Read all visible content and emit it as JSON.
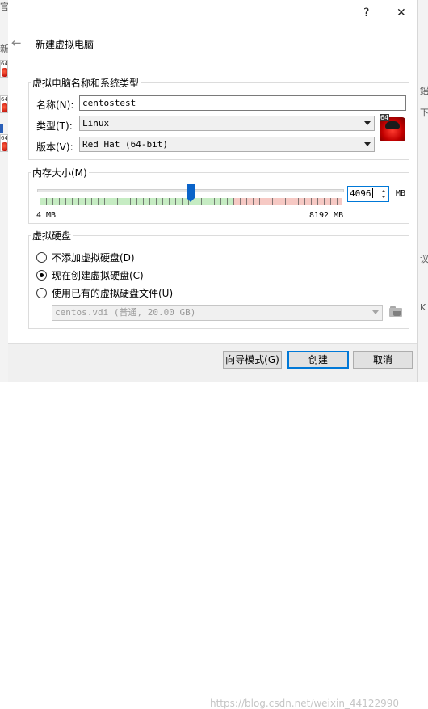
{
  "background": {
    "left_fragments": [
      "官",
      "新"
    ],
    "left_thumb_numbers": [
      "64",
      "64",
      "64"
    ],
    "right_fragments": [
      "鎐",
      "下",
      "议",
      "K"
    ]
  },
  "header": {
    "help_icon": "?",
    "close_icon": "✕",
    "back_icon": "←",
    "title": "新建虚拟电脑"
  },
  "name_group": {
    "legend": "虚拟电脑名称和系统类型",
    "name_label": "名称(N):",
    "name_value": "centostest",
    "type_label": "类型(T):",
    "type_value": "Linux",
    "version_label": "版本(V):",
    "version_value": "Red Hat (64-bit)",
    "os_badge": "64"
  },
  "memory_group": {
    "legend": "内存大小(M)",
    "min_label": "4 MB",
    "max_label": "8192 MB",
    "value": "4096",
    "unit": "MB",
    "slider_value": 4096,
    "slider_min": 4,
    "slider_max": 8192,
    "recommended_max_fraction": 0.64
  },
  "disk_group": {
    "legend": "虚拟硬盘",
    "options": [
      {
        "label": "不添加虚拟硬盘(D)",
        "checked": false
      },
      {
        "label": "现在创建虚拟硬盘(C)",
        "checked": true
      },
      {
        "label": "使用已有的虚拟硬盘文件(U)",
        "checked": false
      }
    ],
    "existing_file": "centos.vdi (普通, 20.00 GB)"
  },
  "footer": {
    "guided_mode_label": "向导模式(G)",
    "create_label": "创建",
    "cancel_label": "取消",
    "watermark": "https://blog.csdn.net/weixin_44122990"
  },
  "colors": {
    "accent": "#0078d7",
    "slider_handle": "#0a63c9",
    "safe_zone": "#c6ecc3",
    "warn_zone": "#f6c9c4"
  }
}
